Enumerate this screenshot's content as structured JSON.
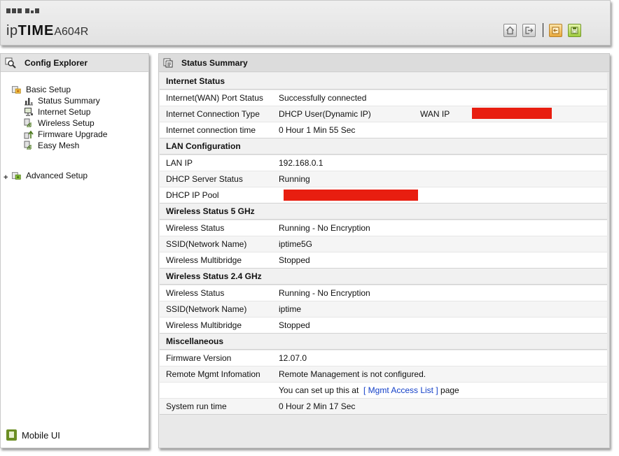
{
  "header": {
    "brand_prefix": "ip",
    "brand_mark": "TIME",
    "model": "A604R",
    "icons": [
      "home-icon",
      "logout-icon",
      "apply-icon",
      "save-icon"
    ]
  },
  "left_panel": {
    "title": "Config Explorer",
    "basic_setup": "Basic Setup",
    "items": [
      "Status Summary",
      "Internet Setup",
      "Wireless Setup",
      "Firmware Upgrade",
      "Easy Mesh"
    ],
    "advanced_setup": "Advanced Setup",
    "mobile_ui": "Mobile UI"
  },
  "right_panel": {
    "title": "Status Summary",
    "sections": {
      "internet": {
        "title": "Internet Status",
        "wan_port_label": "Internet(WAN) Port Status",
        "wan_port_value": "Successfully connected",
        "conn_type_label": "Internet Connection Type",
        "conn_type_value": "DHCP User(Dynamic IP)",
        "wan_ip_label": "WAN IP",
        "conn_time_label": "Internet connection time",
        "conn_time_value": "0 Hour 1 Min 55 Sec"
      },
      "lan": {
        "title": "LAN Configuration",
        "lan_ip_label": "LAN IP",
        "lan_ip_value": "192.168.0.1",
        "dhcp_server_label": "DHCP Server Status",
        "dhcp_server_value": "Running",
        "dhcp_pool_label": "DHCP IP Pool"
      },
      "wireless5": {
        "title": "Wireless Status 5 GHz",
        "status_label": "Wireless Status",
        "status_value": "Running - No Encryption",
        "ssid_label": "SSID(Network Name)",
        "ssid_value": "iptime5G",
        "multibridge_label": "Wireless Multibridge",
        "multibridge_value": "Stopped"
      },
      "wireless24": {
        "title": "Wireless Status 2.4 GHz",
        "status_label": "Wireless Status",
        "status_value": "Running - No Encryption",
        "ssid_label": "SSID(Network Name)",
        "ssid_value": "iptime",
        "multibridge_label": "Wireless Multibridge",
        "multibridge_value": "Stopped"
      },
      "misc": {
        "title": "Miscellaneous",
        "firmware_label": "Firmware Version",
        "firmware_value": "12.07.0",
        "remote_label": "Remote Mgmt Infomation",
        "remote_value": "Remote Management is not configured.",
        "remote_hint_prefix": "You can set up this at",
        "remote_hint_link": "[ Mgmt Access List ]",
        "remote_hint_suffix": "page",
        "runtime_label": "System run time",
        "runtime_value": "0 Hour 2 Min 17 Sec"
      }
    }
  },
  "colors": {
    "redaction": "#e81e10",
    "link": "#1440c8"
  }
}
